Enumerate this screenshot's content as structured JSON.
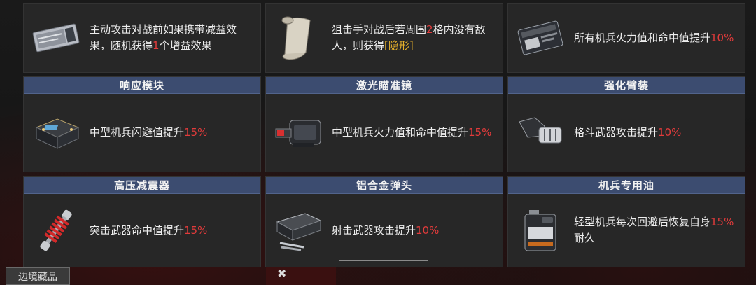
{
  "items": [
    {
      "name": "",
      "desc_parts": [
        {
          "t": "主动攻击对战前如果携带减益效果，随机获得"
        },
        {
          "t": "1",
          "c": "red"
        },
        {
          "t": "个增益效果"
        }
      ],
      "icon": "ticket-icon"
    },
    {
      "name": "",
      "desc_parts": [
        {
          "t": "狙击手对战后若周围"
        },
        {
          "t": "2",
          "c": "red"
        },
        {
          "t": "格内没有敌人，则获得"
        },
        {
          "t": "[隐形]",
          "c": "gold"
        }
      ],
      "icon": "scroll-icon"
    },
    {
      "name": "",
      "desc_parts": [
        {
          "t": "所有机兵火力值和命中值提升"
        },
        {
          "t": "10%",
          "c": "red"
        }
      ],
      "icon": "chip-card-icon"
    },
    {
      "name": "响应模块",
      "desc_parts": [
        {
          "t": "中型机兵闪避值提升"
        },
        {
          "t": "15%",
          "c": "red"
        }
      ],
      "icon": "module-icon"
    },
    {
      "name": "激光瞄准镜",
      "desc_parts": [
        {
          "t": "中型机兵火力值和命中值提升"
        },
        {
          "t": "15%",
          "c": "red"
        }
      ],
      "icon": "laser-sight-icon"
    },
    {
      "name": "强化臂装",
      "desc_parts": [
        {
          "t": "格斗武器攻击提升"
        },
        {
          "t": "10%",
          "c": "red"
        }
      ],
      "icon": "arm-gauntlet-icon"
    },
    {
      "name": "高压减震器",
      "desc_parts": [
        {
          "t": "突击武器命中值提升"
        },
        {
          "t": "15%",
          "c": "red"
        }
      ],
      "icon": "shock-absorber-icon"
    },
    {
      "name": "铝合金弹头",
      "desc_parts": [
        {
          "t": "射击武器攻击提升"
        },
        {
          "t": "10%",
          "c": "red"
        }
      ],
      "icon": "ammo-case-icon"
    },
    {
      "name": "机兵专用油",
      "desc_parts": [
        {
          "t": "轻型机兵每次回避后恢复自身"
        },
        {
          "t": "15%",
          "c": "red"
        },
        {
          "t": "耐久"
        }
      ],
      "icon": "oil-can-icon"
    }
  ],
  "footer": {
    "tab_label": "边境藏品"
  },
  "colors": {
    "header": "#3c4c70",
    "highlight_red": "#e23b3b",
    "highlight_gold": "#e8b22b",
    "cell_bg": "#272727"
  }
}
